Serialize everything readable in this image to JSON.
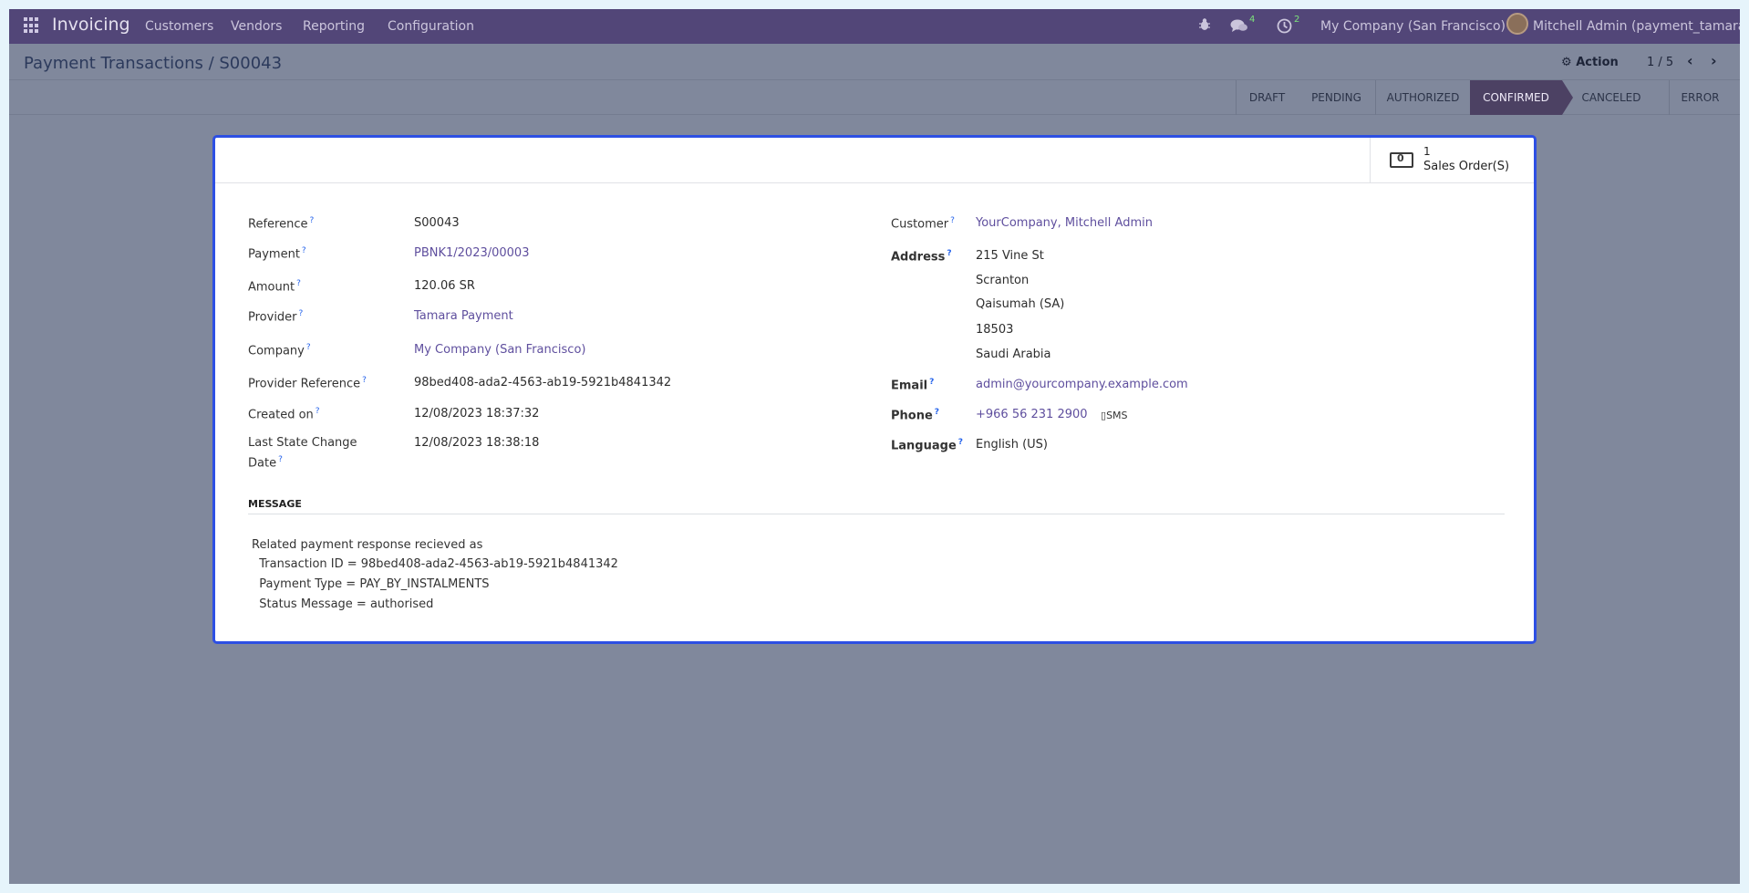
{
  "navbar": {
    "brand": "Invoicing",
    "menu": [
      "Customers",
      "Vendors",
      "Reporting",
      "Configuration"
    ],
    "messages_count": "4",
    "activities_count": "2",
    "company": "My Company (San Francisco)",
    "user": "Mitchell Admin (payment_tamara)"
  },
  "control": {
    "breadcrumb": "Payment Transactions / S00043",
    "action_label": "Action",
    "pager": "1 / 5"
  },
  "stages": [
    "DRAFT",
    "PENDING",
    "AUTHORIZED",
    "CONFIRMED",
    "CANCELED",
    "ERROR"
  ],
  "active_stage": "CONFIRMED",
  "smart_button": {
    "count": "1",
    "label": "Sales Order(S)"
  },
  "left_fields": [
    {
      "label": "Reference",
      "value": "S00043"
    },
    {
      "label": "Payment",
      "value": "PBNK1/2023/00003"
    },
    {
      "label": "Amount",
      "value": "120.06 SR"
    },
    {
      "label": "Provider",
      "value": "Tamara Payment"
    },
    {
      "label": "Company",
      "value": "My Company (San Francisco)"
    },
    {
      "label": "Provider Reference",
      "value": "98bed408-ada2-4563-ab19-5921b4841342"
    },
    {
      "label": "Created on",
      "value": "12/08/2023 18:37:32"
    },
    {
      "label_line1": "Last State Change",
      "label_line2": "Date",
      "value": "12/08/2023 18:38:18"
    }
  ],
  "right_fields": {
    "customer_label": "Customer",
    "customer": "YourCompany, Mitchell Admin",
    "address_label": "Address",
    "address_lines": [
      "215 Vine St",
      "Scranton",
      "Qaisumah (SA)",
      "18503",
      "Saudi Arabia"
    ],
    "email_label": "Email",
    "email": "admin@yourcompany.example.com",
    "phone_label": "Phone",
    "phone": "+966 56 231 2900",
    "sms_label": "SMS",
    "language_label": "Language",
    "language": "English (US)"
  },
  "message": {
    "title": "MESSAGE",
    "lines": [
      "Related payment response recieved as",
      "  Transaction ID = 98bed408-ada2-4563-ab19-5921b4841342",
      "  Payment Type = PAY_BY_INSTALMENTS",
      "  Status Message = authorised"
    ]
  }
}
